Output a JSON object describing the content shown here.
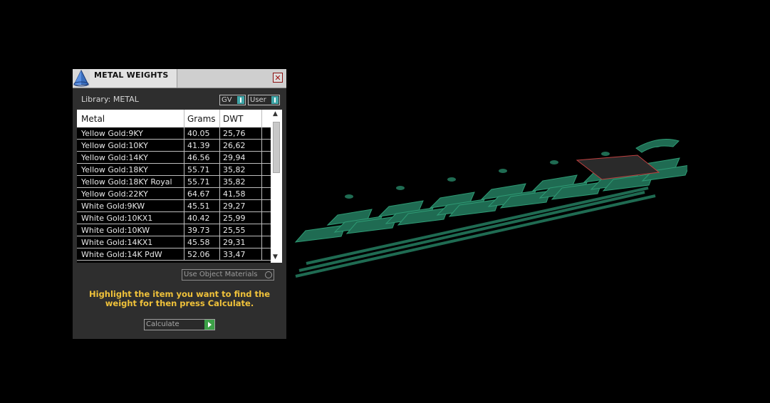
{
  "window": {
    "title": "METAL WEIGHTS",
    "close_glyph": "✕"
  },
  "library": {
    "label": "Library: METAL",
    "buttons": [
      "GV",
      "User"
    ]
  },
  "table": {
    "columns": [
      "Metal",
      "Grams",
      "DWT"
    ],
    "rows": [
      [
        "Yellow Gold:9KY",
        "40.05",
        "25,76"
      ],
      [
        "Yellow Gold:10KY",
        "41.39",
        "26,62"
      ],
      [
        "Yellow Gold:14KY",
        "46.56",
        "29,94"
      ],
      [
        "Yellow Gold:18KY",
        "55.71",
        "35,82"
      ],
      [
        "Yellow Gold:18KY Royal",
        "55.71",
        "35,82"
      ],
      [
        "Yellow Gold:22KY",
        "64.67",
        "41,58"
      ],
      [
        "White Gold:9KW",
        "45.51",
        "29,27"
      ],
      [
        "White Gold:10KX1",
        "40.42",
        "25,99"
      ],
      [
        "White Gold:10KW",
        "39.73",
        "25,55"
      ],
      [
        "White Gold:14KX1",
        "45.58",
        "29,31"
      ],
      [
        "White Gold:14K PdW",
        "52.06",
        "33,47"
      ]
    ]
  },
  "use_object_materials": "Use Object Materials",
  "hint": "Highlight the item you want to find the weight for then press Calculate.",
  "calculate_label": "Calculate",
  "colors": {
    "accent": "#3fa6a8",
    "hint": "#f0c23a",
    "model": "#1f6b52"
  },
  "icons": {
    "logo": "pyramid-logo-icon",
    "close": "close-icon",
    "calculate": "play-arrow-icon"
  }
}
